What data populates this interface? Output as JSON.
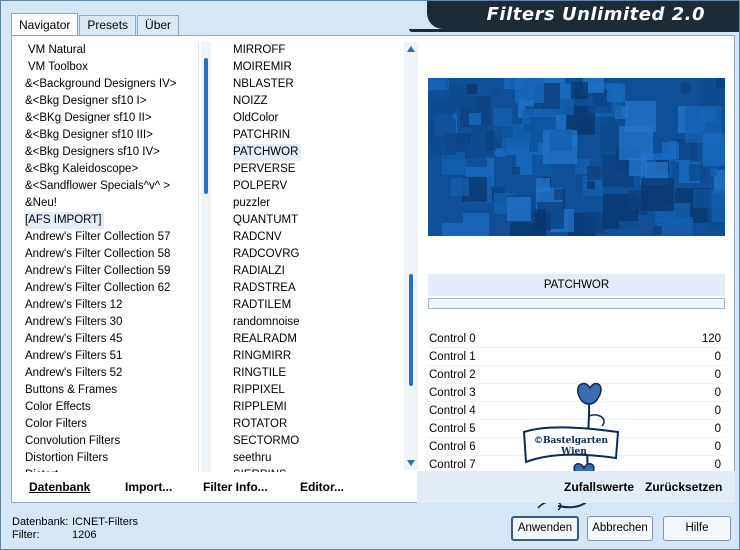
{
  "app": {
    "title": "Filters Unlimited 2.0"
  },
  "tabs": [
    {
      "label": "Navigator",
      "active": true
    },
    {
      "label": "Presets",
      "active": false
    },
    {
      "label": "Über",
      "active": false
    }
  ],
  "categories": {
    "items": [
      "VM Natural",
      "VM Toolbox",
      "&<Background Designers IV>",
      "&<Bkg Designer sf10 I>",
      "&<BKg Designer sf10 II>",
      "&<Bkg Designer sf10 III>",
      "&<Bkg Designers sf10 IV>",
      "&<Bkg Kaleidoscope>",
      "&<Sandflower Specials^v^ >",
      "&Neu!",
      "[AFS IMPORT]",
      "Andrew's Filter Collection 57",
      "Andrew's Filter Collection 58",
      "Andrew's Filter Collection 59",
      "Andrew's Filter Collection 62",
      "Andrew's Filters 12",
      "Andrew's Filters 30",
      "Andrew's Filters 45",
      "Andrew's Filters 51",
      "Andrew's Filters 52",
      "Buttons & Frames",
      "Color Effects",
      "Color Filters",
      "Convolution Filters",
      "Distortion Filters",
      "Distort"
    ],
    "selected": "[AFS IMPORT]"
  },
  "filters": {
    "items": [
      "MIRROFF",
      "MOIREMIR",
      "NBLASTER",
      "NOIZZ",
      "OldColor",
      "PATCHRIN",
      "PATCHWOR",
      "PERVERSE",
      "POLPERV",
      "puzzler",
      "QUANTUMT",
      "RADCNV",
      "RADCOVRG",
      "RADIALZI",
      "RADSTREA",
      "RADTILEM",
      "randomnoise",
      "REALRADM",
      "RINGMIRR",
      "RINGTILE",
      "RIPPIXEL",
      "RIPPLEMI",
      "ROTATOR",
      "SECTORMO",
      "seethru",
      "SIERPINS"
    ],
    "selected": "PATCHWOR"
  },
  "preview": {
    "filter_name": "PATCHWOR",
    "base_color": "#0f4f98"
  },
  "controls": [
    {
      "label": "Control 0",
      "value": "120"
    },
    {
      "label": "Control 1",
      "value": "0"
    },
    {
      "label": "Control 2",
      "value": "0"
    },
    {
      "label": "Control 3",
      "value": "0"
    },
    {
      "label": "Control 4",
      "value": "0"
    },
    {
      "label": "Control 5",
      "value": "0"
    },
    {
      "label": "Control 6",
      "value": "0"
    },
    {
      "label": "Control 7",
      "value": "0"
    }
  ],
  "watermark": {
    "text_line1": "©Bastelgarten",
    "text_line2": "Wien"
  },
  "commands": {
    "database": "Datenbank",
    "import": "Import...",
    "filter_info": "Filter Info...",
    "editor": "Editor...",
    "randomize": "Zufallswerte",
    "reset": "Zurücksetzen"
  },
  "status": {
    "database_label": "Datenbank:",
    "database_value": "ICNET-Filters",
    "filter_label": "Filter:",
    "filter_value": "1206"
  },
  "buttons": {
    "apply": "Anwenden",
    "cancel": "Abbrechen",
    "help": "Hilfe"
  },
  "colors": {
    "accent": "#2c6fc0",
    "banner": "#1d2b36",
    "window_bg": "#d6e6f4"
  }
}
